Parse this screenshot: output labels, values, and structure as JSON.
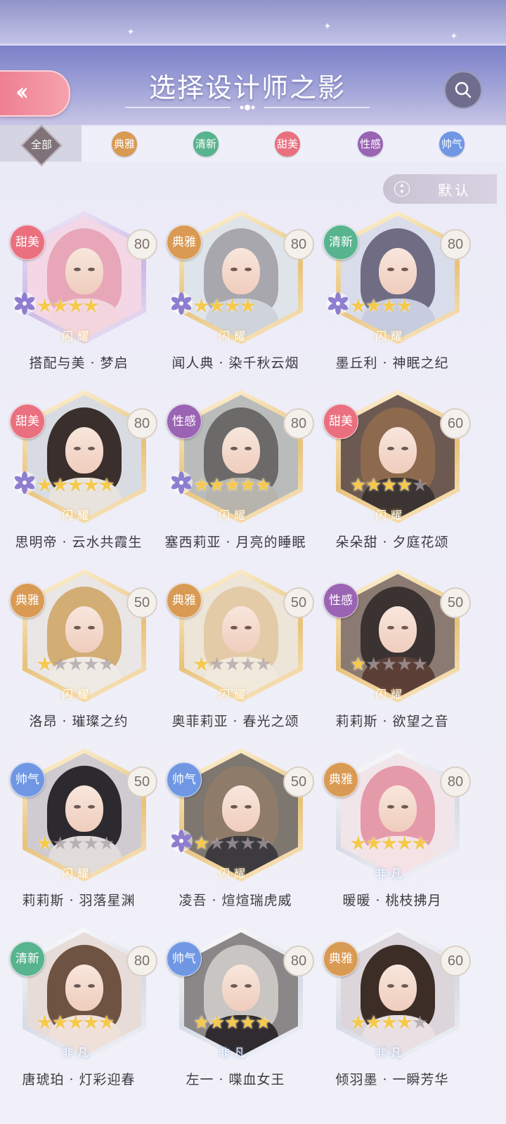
{
  "header": {
    "title": "选择设计师之影",
    "back_icon": "double-chevron-left-icon",
    "search_icon": "search-icon"
  },
  "tabs": [
    {
      "label": "全部",
      "color": "#7f7379",
      "active": true
    },
    {
      "label": "典雅",
      "color": "#d99a54",
      "active": false
    },
    {
      "label": "清新",
      "color": "#58b38f",
      "active": false
    },
    {
      "label": "甜美",
      "color": "#ea6f7f",
      "active": false
    },
    {
      "label": "性感",
      "color": "#9a63b3",
      "active": false
    },
    {
      "label": "帅气",
      "color": "#6f97e3",
      "active": false
    }
  ],
  "sort": {
    "label": "默认",
    "icon": "sort-icon"
  },
  "cards": [
    {
      "name": "搭配与美 · 梦启",
      "style": "甜美",
      "level": "80",
      "stars": 4,
      "max_stars": 4,
      "rarity": "闪耀",
      "frame": "purple"
    },
    {
      "name": "闻人典 · 染千秋云烟",
      "style": "典雅",
      "level": "80",
      "stars": 4,
      "max_stars": 4,
      "rarity": "闪耀",
      "frame": "gold"
    },
    {
      "name": "墨丘利 · 神眠之纪",
      "style": "清新",
      "level": "80",
      "stars": 4,
      "max_stars": 4,
      "rarity": "闪耀",
      "frame": "gold"
    },
    {
      "name": "思明帝 · 云水共霞生",
      "style": "甜美",
      "level": "80",
      "stars": 5,
      "max_stars": 5,
      "rarity": "闪耀",
      "frame": "gold"
    },
    {
      "name": "塞西莉亚 · 月亮的睡眠",
      "style": "性感",
      "level": "80",
      "stars": 5,
      "max_stars": 5,
      "rarity": "闪耀",
      "frame": "gold"
    },
    {
      "name": "朵朵甜 · 夕庭花颂",
      "style": "甜美",
      "level": "60",
      "stars": 4,
      "max_stars": 5,
      "rarity": "闪耀",
      "frame": "gold"
    },
    {
      "name": "洛昂 · 璀璨之约",
      "style": "典雅",
      "level": "50",
      "stars": 1,
      "max_stars": 5,
      "rarity": "闪耀",
      "frame": "gold"
    },
    {
      "name": "奥菲莉亚 · 春光之颂",
      "style": "典雅",
      "level": "50",
      "stars": 1,
      "max_stars": 5,
      "rarity": "闪耀",
      "frame": "gold"
    },
    {
      "name": "莉莉斯 · 欲望之音",
      "style": "性感",
      "level": "50",
      "stars": 1,
      "max_stars": 5,
      "rarity": "闪耀",
      "frame": "gold"
    },
    {
      "name": "莉莉斯 · 羽落星渊",
      "style": "帅气",
      "level": "50",
      "stars": 1,
      "max_stars": 5,
      "rarity": "闪耀",
      "frame": "gold"
    },
    {
      "name": "凌吾 · 煊煊瑞虎威",
      "style": "帅气",
      "level": "50",
      "stars": 1,
      "max_stars": 5,
      "rarity": "闪耀",
      "frame": "gold"
    },
    {
      "name": "暖暖 · 桃枝拂月",
      "style": "典雅",
      "level": "80",
      "stars": 5,
      "max_stars": 5,
      "rarity": "非凡",
      "frame": "silver"
    },
    {
      "name": "唐琥珀 · 灯彩迎春",
      "style": "清新",
      "level": "80",
      "stars": 5,
      "max_stars": 5,
      "rarity": "非凡",
      "frame": "silver"
    },
    {
      "name": "左一 · 喋血女王",
      "style": "帅气",
      "level": "80",
      "stars": 5,
      "max_stars": 5,
      "rarity": "非凡",
      "frame": "silver"
    },
    {
      "name": "倾羽墨 · 一瞬芳华",
      "style": "典雅",
      "level": "60",
      "stars": 4,
      "max_stars": 5,
      "rarity": "非凡",
      "frame": "silver"
    }
  ],
  "style_colors": {
    "甜美": "#ea6f7f",
    "典雅": "#d99a54",
    "清新": "#58b38f",
    "性感": "#9a63b3",
    "帅气": "#6f97e3"
  },
  "portraits": [
    {
      "hair": "#e7a7b8",
      "body": "#f2d5df",
      "bg": "#f3d7e6"
    },
    {
      "hair": "#a8a7ad",
      "body": "#cfd3dc",
      "bg": "#dfe4ea"
    },
    {
      "hair": "#6f6c84",
      "body": "#c7cce0",
      "bg": "#d9dceb"
    },
    {
      "hair": "#3a2f2c",
      "body": "#e9e3de",
      "bg": "#d8dce2"
    },
    {
      "hair": "#6b6a68",
      "body": "#b7b3ad",
      "bg": "#b9bcbb"
    },
    {
      "hair": "#8d6a4e",
      "body": "#3c3432",
      "bg": "#6c5a52"
    },
    {
      "hair": "#d2ad74",
      "body": "#efeae4",
      "bg": "#e9e6e5"
    },
    {
      "hair": "#e3cba7",
      "body": "#f1e9dc",
      "bg": "#ece5d8"
    },
    {
      "hair": "#3a3331",
      "body": "#5b3f36",
      "bg": "#8a7a72"
    },
    {
      "hair": "#2c2a2f",
      "body": "#e1dcdb",
      "bg": "#cfcbd0"
    },
    {
      "hair": "#8e7b69",
      "body": "#3d3b3f",
      "bg": "#7d7770"
    },
    {
      "hair": "#e59aaa",
      "body": "#f4e2e5",
      "bg": "#f1e5ea"
    },
    {
      "hair": "#6e5242",
      "body": "#efe1da",
      "bg": "#e7dcd7"
    },
    {
      "hair": "#c9c5c3",
      "body": "#2f2b2e",
      "bg": "#8b8788"
    },
    {
      "hair": "#3c2d27",
      "body": "#e8e0e3",
      "bg": "#dcd6da"
    }
  ]
}
